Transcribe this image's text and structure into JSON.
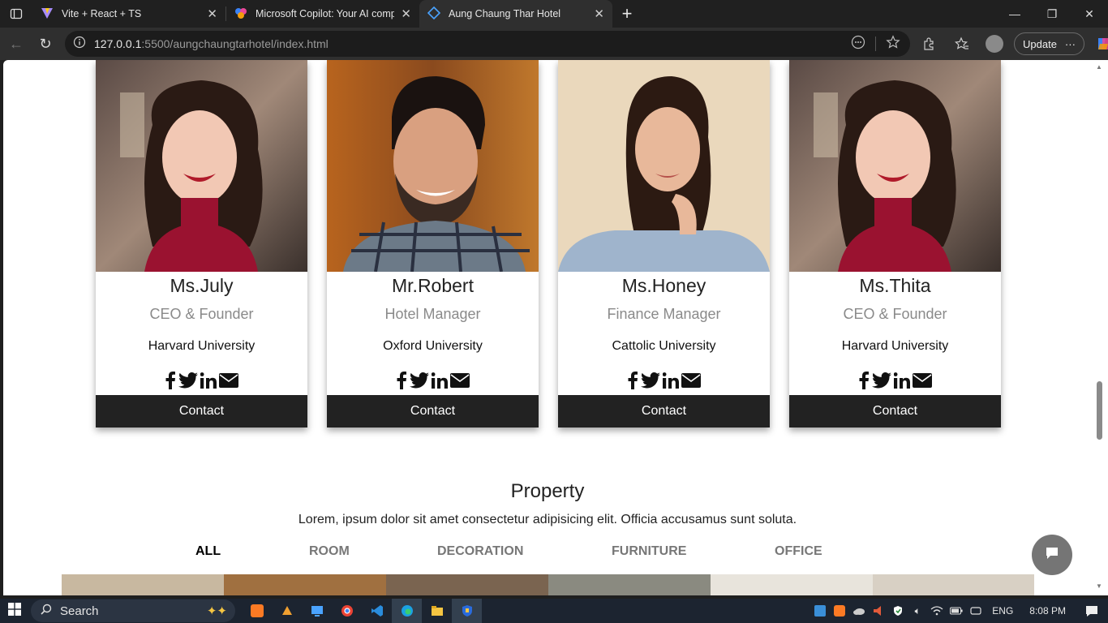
{
  "browser": {
    "tabs": [
      {
        "title": "Vite + React + TS",
        "active": false
      },
      {
        "title": "Microsoft Copilot: Your AI compa",
        "active": false
      },
      {
        "title": "Aung Chaung Thar Hotel",
        "active": true
      }
    ],
    "url_host": "127.0.0.1",
    "url_rest": ":5500/aungchaungtarhotel/index.html",
    "update_label": "Update"
  },
  "team": [
    {
      "name": "Ms.July",
      "role": "CEO & Founder",
      "school": "Harvard University",
      "contact": "Contact"
    },
    {
      "name": "Mr.Robert",
      "role": "Hotel Manager",
      "school": "Oxford University",
      "contact": "Contact"
    },
    {
      "name": "Ms.Honey",
      "role": "Finance Manager",
      "school": "Cattolic University",
      "contact": "Contact"
    },
    {
      "name": "Ms.Thita",
      "role": "CEO & Founder",
      "school": "Harvard University",
      "contact": "Contact"
    }
  ],
  "property": {
    "title": "Property",
    "subtitle": "Lorem, ipsum dolor sit amet consectetur adipisicing elit. Officia accusamus sunt soluta.",
    "filters": [
      "ALL",
      "ROOM",
      "DECORATION",
      "FURNITURE",
      "OFFICE"
    ],
    "active_filter": "ALL"
  },
  "taskbar": {
    "search_label": "Search",
    "language": "ENG",
    "time": "8:08 PM"
  },
  "colors": {
    "contact_bg": "#222222",
    "chat_fab": "#757575",
    "taskbar": "#1c2430"
  }
}
